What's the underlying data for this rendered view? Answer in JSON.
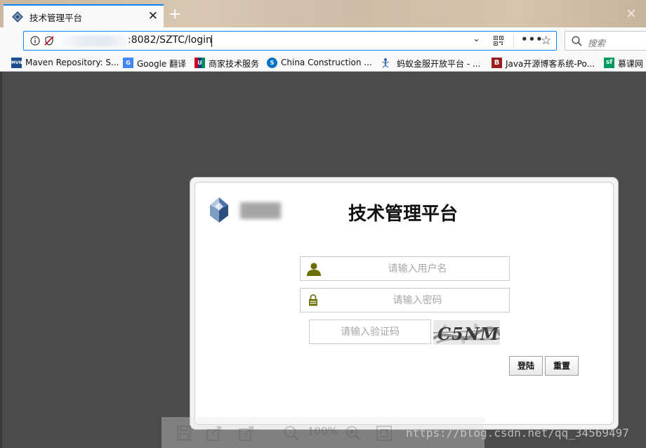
{
  "browser": {
    "tab": {
      "title": "技术管理平台",
      "close": "✕"
    },
    "new_tab": "+",
    "window_close": "✕",
    "url": {
      "visible": ":8082/SZTC/login"
    },
    "search": {
      "placeholder": "搜索"
    },
    "bookmarks": [
      {
        "label": "Maven Repository: S...",
        "icon": "mvn-icon",
        "icon_text": "MVN",
        "color": "#1a4c8e"
      },
      {
        "label": "Google 翻译",
        "icon": "google-translate-icon",
        "icon_text": "G",
        "color": "#4285f4"
      },
      {
        "label": "商家技术服务",
        "icon": "unionpay-icon",
        "icon_text": "U",
        "color": "#d0021b"
      },
      {
        "label": "China Construction ...",
        "icon": "sharepoint-icon",
        "icon_text": "S",
        "color": "#0072c6"
      },
      {
        "label": "蚂蚁金服开放平台 - ...",
        "icon": "ant-icon",
        "icon_text": "",
        "color": "#3d6fb6"
      },
      {
        "label": "Java开源博客系统-Po...",
        "icon": "b-icon",
        "icon_text": "B",
        "color": "#9b1c1c"
      },
      {
        "label": "慕课网",
        "icon": "sf-icon",
        "icon_text": "sf",
        "color": "#009a61"
      }
    ]
  },
  "login": {
    "title": "技术管理平台",
    "username_placeholder": "请输入用户名",
    "password_placeholder": "请输入密码",
    "captcha_placeholder": "请输入验证码",
    "captcha_text": "C5NM",
    "login_button": "登陆",
    "reset_button": "重置"
  },
  "overlay": {
    "zoom": "100%",
    "watermark": "https://blog.csdn.net/qq_34569497"
  },
  "colors": {
    "accent": "#0a84ff",
    "page_bg": "#4b4b4b",
    "icon_olive": "#6b7006"
  }
}
